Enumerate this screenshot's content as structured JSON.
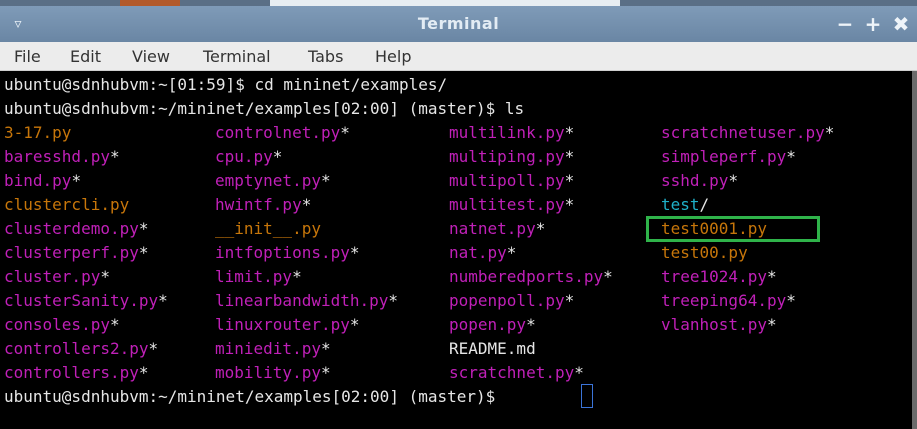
{
  "window": {
    "title": "Terminal",
    "menu_arrow": "▿",
    "minimize": "−",
    "maximize": "+",
    "close": "✖"
  },
  "menubar": [
    "File",
    "Edit",
    "View",
    "Terminal",
    "Tabs",
    "Help"
  ],
  "terminal": {
    "lines": [
      "ubuntu@sdnhubvm:~[01:59]$ cd mininet/examples/",
      "ubuntu@sdnhubvm:~/mininet/examples[02:00] (master)$ ls"
    ],
    "prompt_last": "ubuntu@sdnhubvm:~/mininet/examples[02:00] (master)$ ",
    "colors": {
      "executable": "#c020b8",
      "plain": "#c7760a",
      "directory": "#1fb0c8",
      "highlight": "#2fb34a"
    },
    "listing": [
      [
        {
          "name": "3-17.py",
          "suffix": "",
          "kind": "plain"
        },
        {
          "name": "baresshd.py",
          "suffix": "*",
          "kind": "exe"
        },
        {
          "name": "bind.py",
          "suffix": "*",
          "kind": "exe"
        },
        {
          "name": "clustercli.py",
          "suffix": "",
          "kind": "plain"
        },
        {
          "name": "clusterdemo.py",
          "suffix": "*",
          "kind": "exe"
        },
        {
          "name": "clusterperf.py",
          "suffix": "*",
          "kind": "exe"
        },
        {
          "name": "cluster.py",
          "suffix": "*",
          "kind": "exe"
        },
        {
          "name": "clusterSanity.py",
          "suffix": "*",
          "kind": "exe"
        },
        {
          "name": "consoles.py",
          "suffix": "*",
          "kind": "exe"
        },
        {
          "name": "controllers2.py",
          "suffix": "*",
          "kind": "exe"
        },
        {
          "name": "controllers.py",
          "suffix": "*",
          "kind": "exe"
        }
      ],
      [
        {
          "name": "controlnet.py",
          "suffix": "*",
          "kind": "exe"
        },
        {
          "name": "cpu.py",
          "suffix": "*",
          "kind": "exe"
        },
        {
          "name": "emptynet.py",
          "suffix": "*",
          "kind": "exe"
        },
        {
          "name": "hwintf.py",
          "suffix": "*",
          "kind": "exe"
        },
        {
          "name": "__init__.py",
          "suffix": "",
          "kind": "plain"
        },
        {
          "name": "intfoptions.py",
          "suffix": "*",
          "kind": "exe"
        },
        {
          "name": "limit.py",
          "suffix": "*",
          "kind": "exe"
        },
        {
          "name": "linearbandwidth.py",
          "suffix": "*",
          "kind": "exe"
        },
        {
          "name": "linuxrouter.py",
          "suffix": "*",
          "kind": "exe"
        },
        {
          "name": "miniedit.py",
          "suffix": "*",
          "kind": "exe"
        },
        {
          "name": "mobility.py",
          "suffix": "*",
          "kind": "exe"
        }
      ],
      [
        {
          "name": "multilink.py",
          "suffix": "*",
          "kind": "exe"
        },
        {
          "name": "multiping.py",
          "suffix": "*",
          "kind": "exe"
        },
        {
          "name": "multipoll.py",
          "suffix": "*",
          "kind": "exe"
        },
        {
          "name": "multitest.py",
          "suffix": "*",
          "kind": "exe"
        },
        {
          "name": "natnet.py",
          "suffix": "*",
          "kind": "exe"
        },
        {
          "name": "nat.py",
          "suffix": "*",
          "kind": "exe"
        },
        {
          "name": "numberedports.py",
          "suffix": "*",
          "kind": "exe"
        },
        {
          "name": "popenpoll.py",
          "suffix": "*",
          "kind": "exe"
        },
        {
          "name": "popen.py",
          "suffix": "*",
          "kind": "exe"
        },
        {
          "name": "README.md",
          "suffix": "",
          "kind": "white"
        },
        {
          "name": "scratchnet.py",
          "suffix": "*",
          "kind": "exe"
        }
      ],
      [
        {
          "name": "scratchnetuser.py",
          "suffix": "*",
          "kind": "exe"
        },
        {
          "name": "simpleperf.py",
          "suffix": "*",
          "kind": "exe"
        },
        {
          "name": "sshd.py",
          "suffix": "*",
          "kind": "exe"
        },
        {
          "name": "test",
          "suffix": "/",
          "kind": "dir"
        },
        {
          "name": "test0001.py",
          "suffix": "",
          "kind": "plain",
          "highlighted": true
        },
        {
          "name": "test00.py",
          "suffix": "",
          "kind": "plain"
        },
        {
          "name": "tree1024.py",
          "suffix": "*",
          "kind": "exe"
        },
        {
          "name": "treeping64.py",
          "suffix": "*",
          "kind": "exe"
        },
        {
          "name": "vlanhost.py",
          "suffix": "*",
          "kind": "exe"
        }
      ]
    ]
  }
}
